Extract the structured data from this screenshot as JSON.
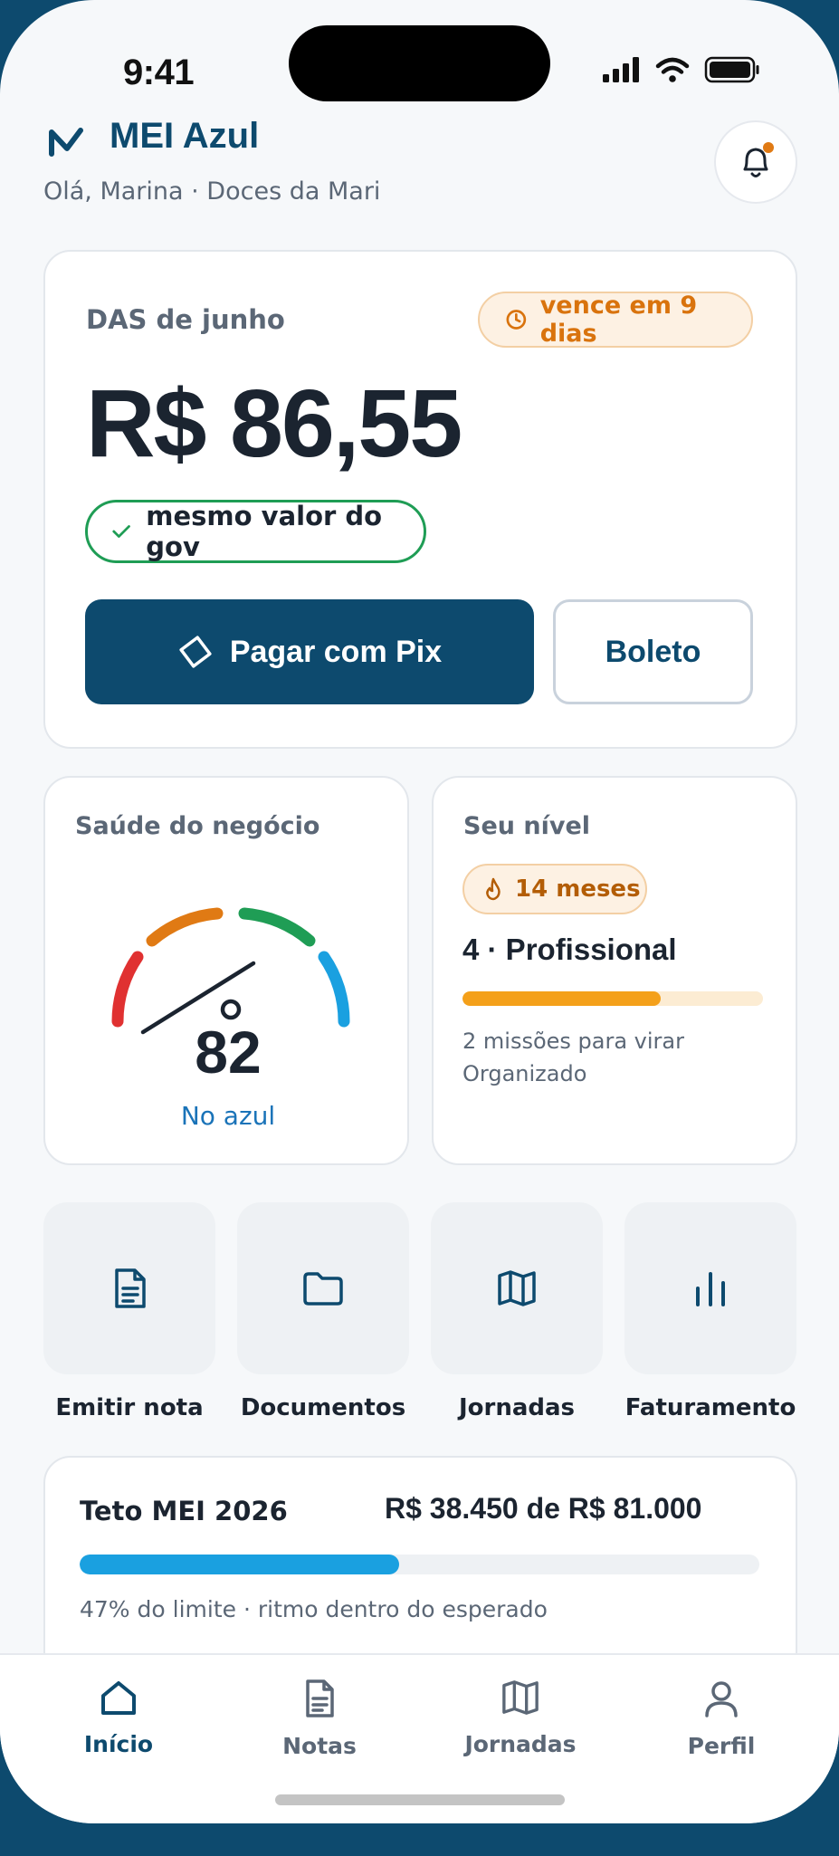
{
  "status_bar": {
    "time": "9:41"
  },
  "header": {
    "brand": "MEI Azul",
    "greeting": "Olá, Marina · Doces da Mari"
  },
  "das": {
    "label": "DAS de junho",
    "due": "vence em 9 dias",
    "amount": "R$ 86,55",
    "same_value": "mesmo valor do gov",
    "pix_label": "Pagar com Pix",
    "boleto_label": "Boleto"
  },
  "health": {
    "title": "Saúde do negócio",
    "score": "82",
    "status": "No azul",
    "score_value": 82
  },
  "level": {
    "title": "Seu nível",
    "streak": "14 meses",
    "name": "4 · Profissional",
    "progress": 0.66,
    "note": "2 missões para virar Organizado"
  },
  "actions": [
    {
      "label": "Emitir nota",
      "icon": "document-icon"
    },
    {
      "label": "Documentos",
      "icon": "folder-icon"
    },
    {
      "label": "Jornadas",
      "icon": "map-icon"
    },
    {
      "label": "Faturamento",
      "icon": "bar-chart-icon"
    }
  ],
  "teto": {
    "title": "Teto MEI 2026",
    "value": "R$ 38.450 de R$ 81.000",
    "progress": 0.47,
    "note": "47% do limite · ritmo dentro do esperado"
  },
  "tabs": [
    {
      "label": "Início",
      "icon": "home-icon",
      "active": true
    },
    {
      "label": "Notas",
      "icon": "document-icon",
      "active": false
    },
    {
      "label": "Jornadas",
      "icon": "map-icon",
      "active": false
    },
    {
      "label": "Perfil",
      "icon": "user-icon",
      "active": false
    }
  ],
  "colors": {
    "brand": "#0d4a6e",
    "accent_orange": "#e07a14",
    "success_green": "#1f9d55",
    "info_blue": "#1aa0e0",
    "gauge": [
      "#e03131",
      "#e07a14",
      "#1f9d55",
      "#1aa0e0"
    ]
  }
}
